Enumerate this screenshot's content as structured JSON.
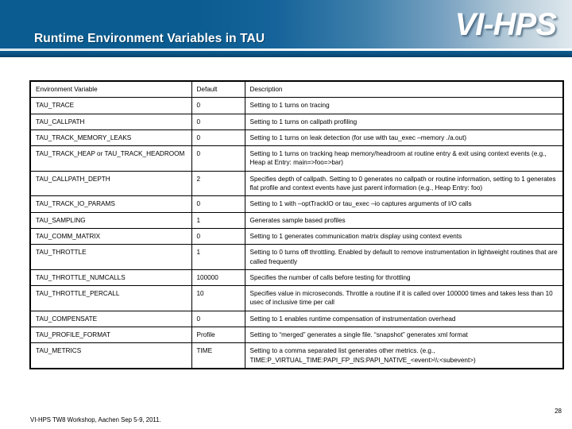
{
  "header": {
    "title": "Runtime Environment Variables in TAU",
    "logo_primary": "VI",
    "logo_sep": "-",
    "logo_secondary": "HPS",
    "banner_color": "#0b5c90",
    "banner_highlight": "#dfe8ee"
  },
  "table": {
    "columns": [
      "Environment Variable",
      "Default",
      "Description"
    ],
    "rows": [
      {
        "variable": "TAU_TRACE",
        "default": "0",
        "description": "Setting to 1 turns on tracing"
      },
      {
        "variable": "TAU_CALLPATH",
        "default": "0",
        "description": "Setting to 1 turns on callpath profiling"
      },
      {
        "variable": "TAU_TRACK_MEMORY_LEAKS",
        "default": "0",
        "description": "Setting to 1 turns on leak detection (for use with tau_exec –memory ./a.out)"
      },
      {
        "variable": "TAU_TRACK_HEAP or TAU_TRACK_HEADROOM",
        "default": "0",
        "description": "Setting to 1 turns on tracking heap memory/headroom at routine entry & exit using context events (e.g., Heap at Entry: main=>foo=>bar)"
      },
      {
        "variable": "TAU_CALLPATH_DEPTH",
        "default": "2",
        "description": "Specifies depth of callpath. Setting to 0 generates no callpath or routine information, setting to 1 generates flat profile and context events have just parent information (e.g., Heap Entry: foo)"
      },
      {
        "variable": "TAU_TRACK_IO_PARAMS",
        "default": "0",
        "description": "Setting to 1 with –optTrackIO or tau_exec –io captures arguments of I/O calls"
      },
      {
        "variable": "TAU_SAMPLING",
        "default": "1",
        "description": "Generates sample based profiles"
      },
      {
        "variable": "TAU_COMM_MATRIX",
        "default": "0",
        "description": "Setting to 1 generates communication matrix display using context events"
      },
      {
        "variable": "TAU_THROTTLE",
        "default": "1",
        "description": "Setting to 0 turns off throttling. Enabled by default to remove instrumentation in lightweight routines that are called frequently"
      },
      {
        "variable": "TAU_THROTTLE_NUMCALLS",
        "default": "100000",
        "description": "Specifies the number of calls before testing for throttling"
      },
      {
        "variable": "TAU_THROTTLE_PERCALL",
        "default": "10",
        "description": "Specifies value in microseconds. Throttle a routine if it is called over 100000 times and takes less than 10 usec of inclusive time per call"
      },
      {
        "variable": "TAU_COMPENSATE",
        "default": "0",
        "description": "Setting to 1 enables runtime compensation of instrumentation overhead"
      },
      {
        "variable": "TAU_PROFILE_FORMAT",
        "default": "Profile",
        "description": "Setting to “merged” generates a single file. “snapshot” generates xml format"
      },
      {
        "variable": "TAU_METRICS",
        "default": "TIME",
        "description": "Setting to a comma separated list generates other metrics. (e.g., TIME:P_VIRTUAL_TIME:PAPI_FP_INS:PAPI_NATIVE_<event>\\\\:<subevent>)"
      }
    ]
  },
  "footer": {
    "page_number": "28",
    "text": "VI-HPS TW8 Workshop, Aachen Sep 5-9, 2011."
  }
}
